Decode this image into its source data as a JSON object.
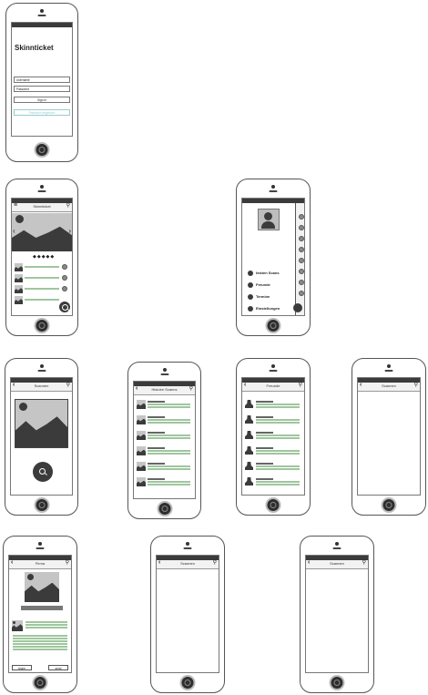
{
  "login": {
    "title": "Skinnticket",
    "username_placeholder": "Username",
    "password_placeholder": "Password",
    "signin_label": "Sign in",
    "secondary_label": "Passwort vergessen"
  },
  "home": {
    "nav_title": "Skinnticket",
    "dots": "◆◆◆◆◆"
  },
  "menu": {
    "items": [
      {
        "label": "letzten Scans"
      },
      {
        "label": "Freunde"
      },
      {
        "label": "Termine"
      },
      {
        "label": "Einstellungen"
      }
    ]
  },
  "scannen": {
    "nav_title": "Scannen"
  },
  "history": {
    "nav_title": "Histoire Scanns"
  },
  "friends": {
    "nav_title": "Freunde"
  },
  "blank1": {
    "nav_title": "Scannen"
  },
  "firma": {
    "nav_title": "Firma",
    "left_button": "share",
    "right_button": "send"
  },
  "blank2": {
    "nav_title": "Scannen"
  },
  "blank3": {
    "nav_title": "Scannen"
  },
  "colors": {
    "device_outline": "#555555",
    "wireframe_dark": "#3b3b3b",
    "accent_green": "#9fc69f",
    "placeholder_gray": "#c5c5c5"
  }
}
